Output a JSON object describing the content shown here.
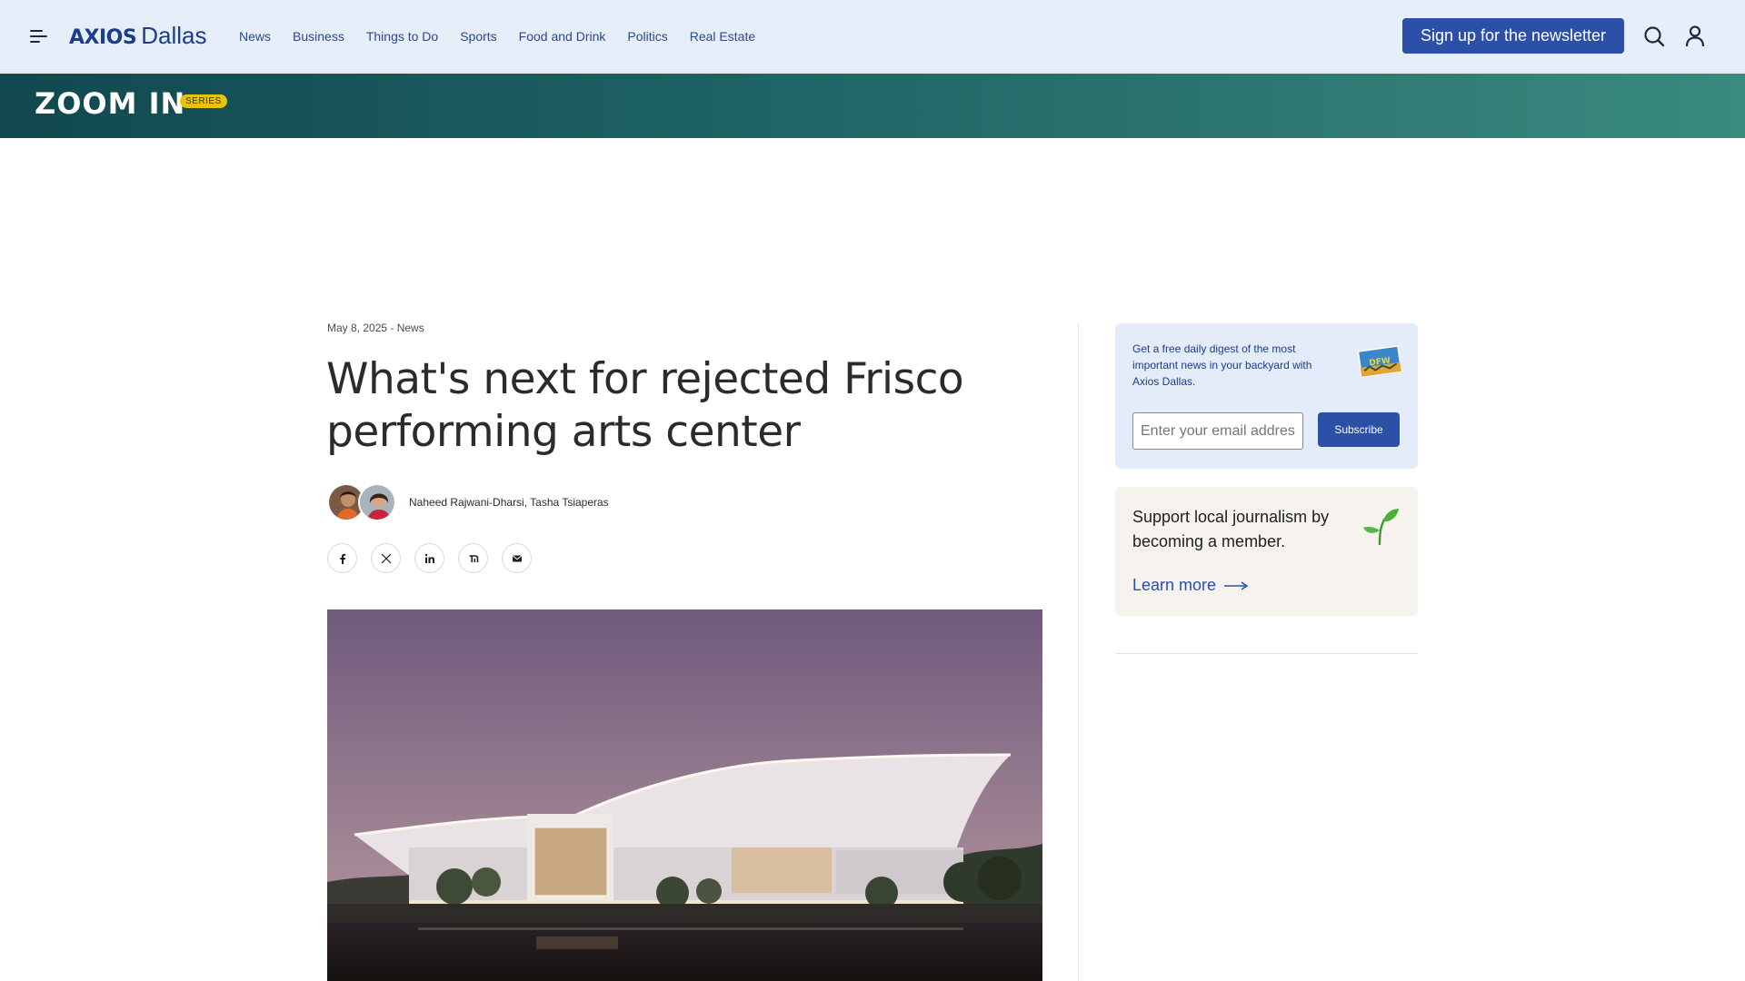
{
  "header": {
    "brand_axios": "AXIOS",
    "brand_city": "Dallas",
    "nav": [
      "News",
      "Business",
      "Things to Do",
      "Sports",
      "Food and Drink",
      "Politics",
      "Real Estate"
    ],
    "signup_label": "Sign up for the newsletter",
    "icons": [
      "menu-icon",
      "search-icon",
      "user-icon"
    ]
  },
  "banner": {
    "title": "ZOOM IN",
    "badge": "SERIES"
  },
  "article": {
    "meta": "May 8, 2025 - News",
    "headline": "What's next for rejected Frisco performing arts center",
    "authors": "Naheed Rajwani-Dharsi, Tasha Tsiaperas",
    "share_icons": [
      "facebook-icon",
      "x-icon",
      "linkedin-icon",
      "threads-icon",
      "email-icon"
    ]
  },
  "sidebar": {
    "newsletter_text": "Get a free daily digest of the most important news in your backyard with Axios Dallas.",
    "email_placeholder": "Enter your email address",
    "subscribe_label": "Subscribe",
    "support_text": "Support local journalism by becoming a member.",
    "learn_more_label": "Learn more"
  },
  "colors": {
    "header_bg": "#e6eef9",
    "brand_blue": "#2c4fa8",
    "banner_dark": "#11484f",
    "banner_light": "#3a8a7e",
    "badge_yellow": "#e8c30e",
    "support_bg": "#f6f3ee"
  }
}
